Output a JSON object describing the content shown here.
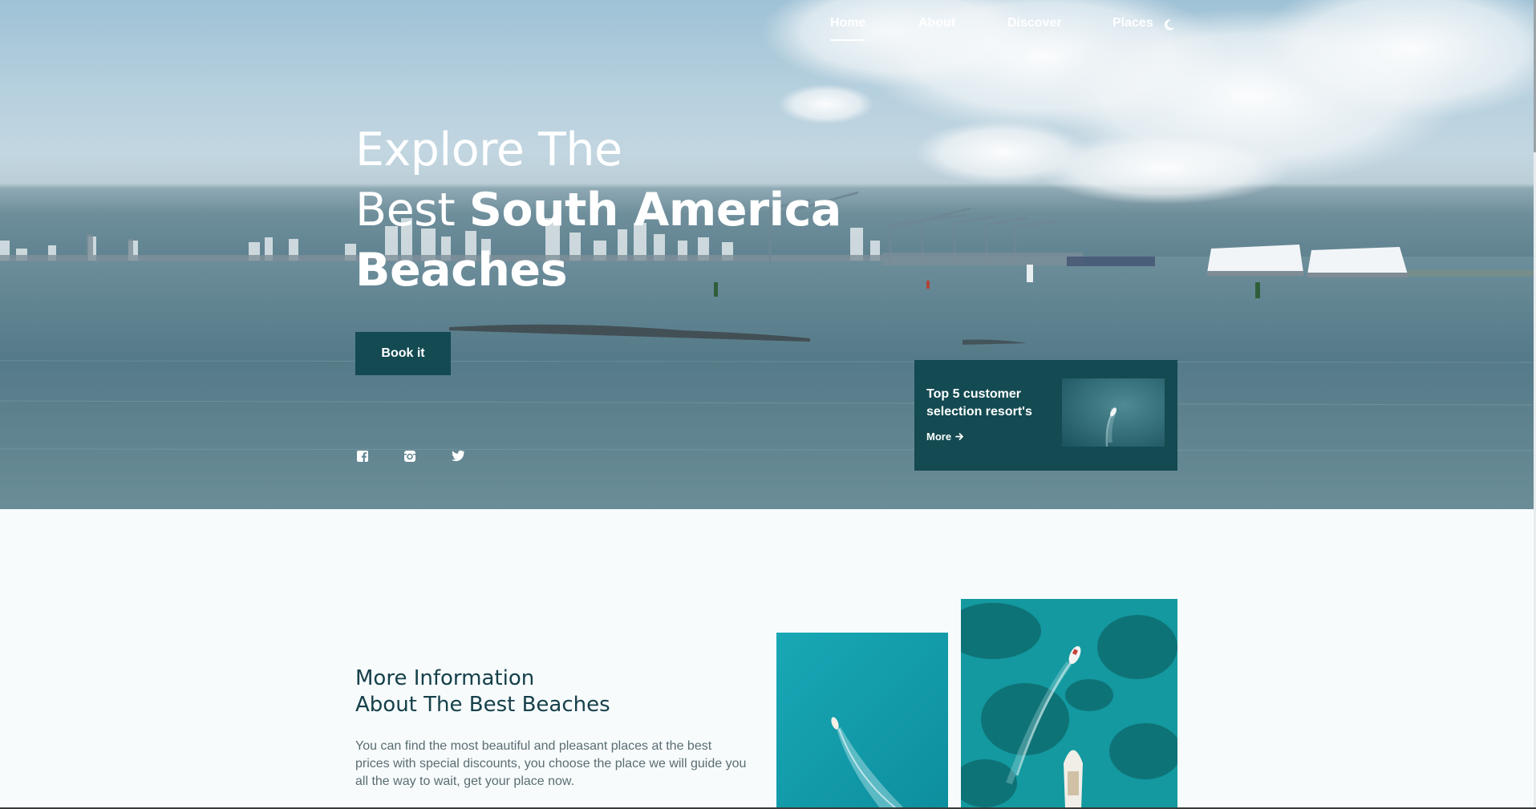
{
  "nav": {
    "items": [
      {
        "label": "Home",
        "active": true
      },
      {
        "label": "About",
        "active": false
      },
      {
        "label": "Discover",
        "active": false
      },
      {
        "label": "Places",
        "active": false
      }
    ],
    "theme_icon": "moon-icon"
  },
  "hero": {
    "title_line1": "Explore The",
    "title_line2_light": "Best",
    "title_line2_bold": "South America",
    "title_line3_bold": "Beaches",
    "button_label": "Book it",
    "social_icons": [
      "facebook-icon",
      "instagram-icon",
      "twitter-icon"
    ]
  },
  "promo": {
    "title": "Top 5 customer selection resort's",
    "more_label": "More"
  },
  "info": {
    "title_line1": "More Information",
    "title_line2": "About The Best Beaches",
    "text": "You can find the most beautiful and pleasant places at the best prices with special discounts, you choose the place we will guide you all the way to wait, get your place now."
  },
  "colors": {
    "primary": "#144a52",
    "heading": "#15404a",
    "body_text": "#5a6d72",
    "page_bg": "#f7fbfc"
  }
}
